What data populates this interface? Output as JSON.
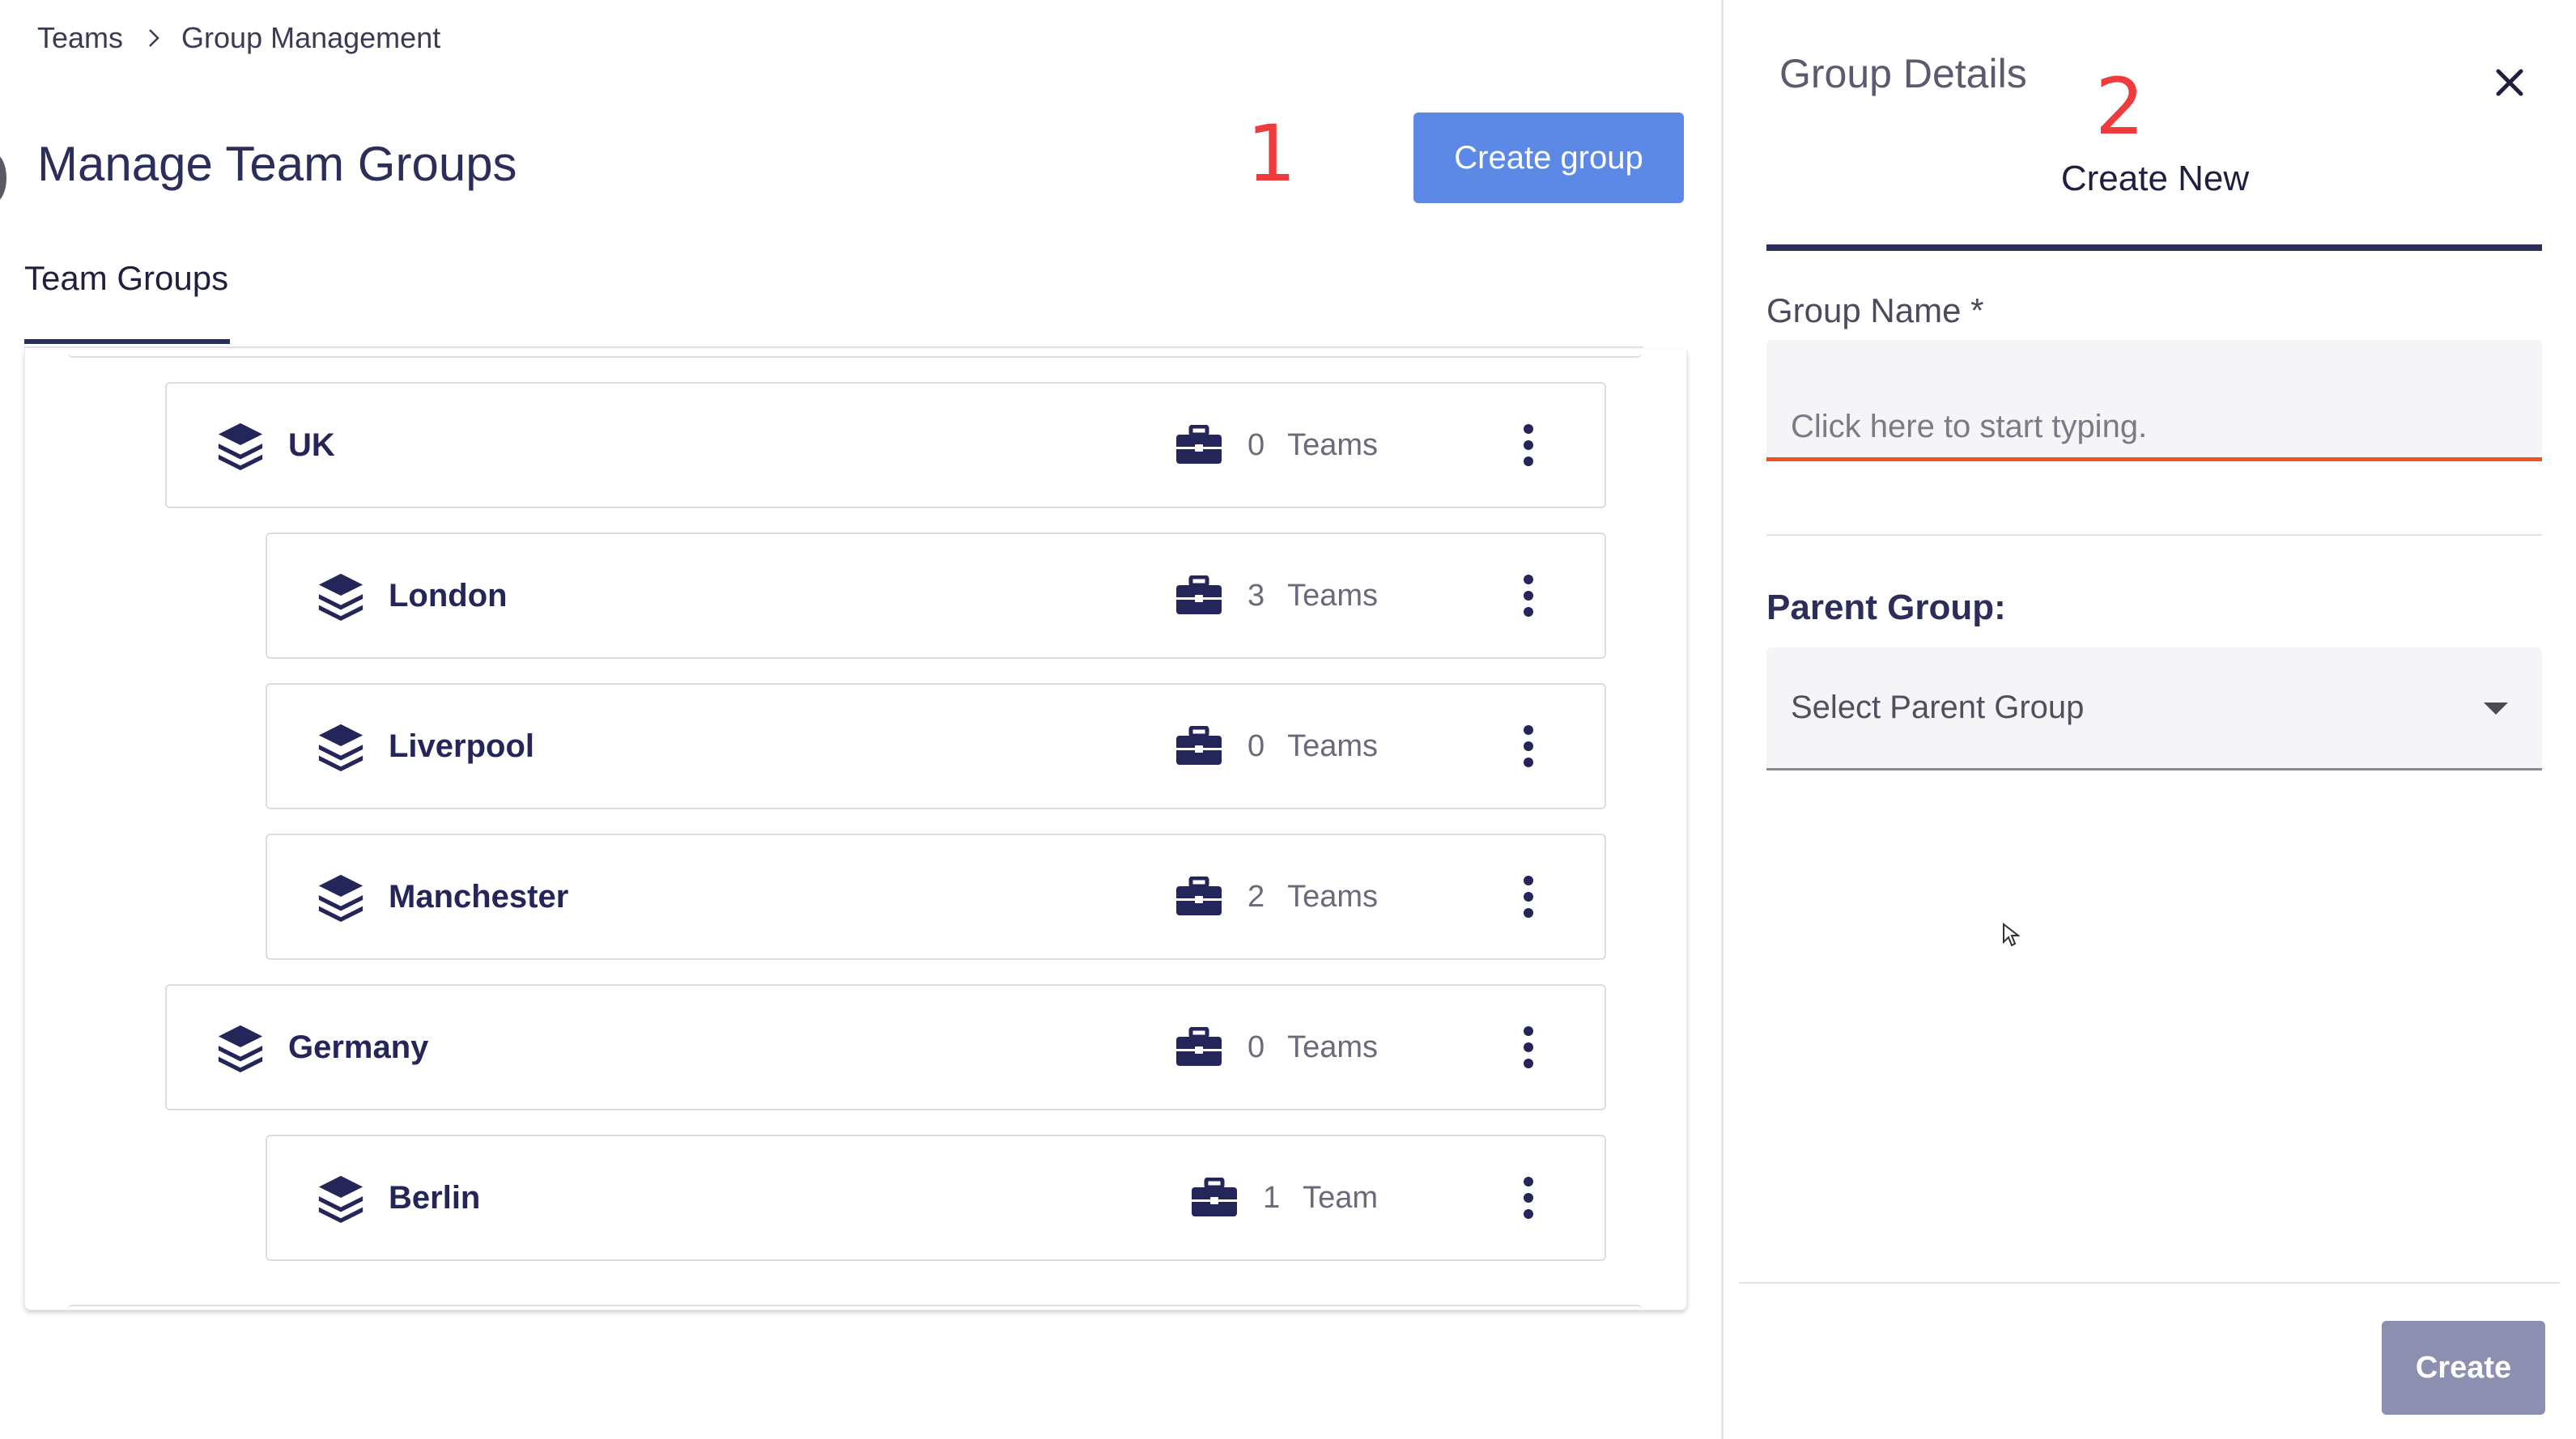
{
  "breadcrumb": {
    "items": [
      "Teams",
      "Group Management"
    ]
  },
  "page": {
    "title": "Manage Team Groups",
    "create_group_label": "Create group"
  },
  "annotations": [
    "1",
    "2"
  ],
  "tabs": {
    "team_groups": "Team Groups"
  },
  "groups": [
    {
      "name": "UK",
      "count": "0",
      "unit": "Teams"
    },
    {
      "name": "London",
      "count": "3",
      "unit": "Teams"
    },
    {
      "name": "Liverpool",
      "count": "0",
      "unit": "Teams"
    },
    {
      "name": "Manchester",
      "count": "2",
      "unit": "Teams"
    },
    {
      "name": "Germany",
      "count": "0",
      "unit": "Teams"
    },
    {
      "name": "Berlin",
      "count": "1",
      "unit": "Team"
    }
  ],
  "panel": {
    "title": "Group Details",
    "tab": "Create New",
    "group_name_label": "Group Name *",
    "group_name_placeholder": "Click here to start typing.",
    "group_name_value": "",
    "parent_group_label": "Parent Group:",
    "parent_group_value": "Select Parent Group",
    "create_label": "Create"
  },
  "colors": {
    "primary": "#5c89e6",
    "navy": "#2b2d5a",
    "error_underline": "#e8541e",
    "disabled_button": "#8c8faf",
    "annotation": "#ef3b3b"
  }
}
